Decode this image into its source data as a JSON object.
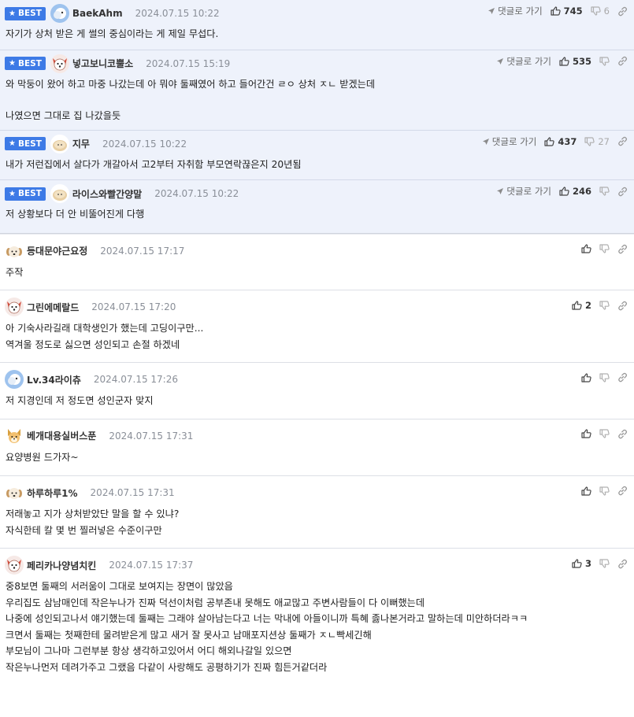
{
  "labels": {
    "best": "BEST",
    "reply": "댓글로 가기"
  },
  "colors": {
    "best_badge": "#3d7ae6",
    "best_bg": "#eef2fb"
  },
  "best_comments": [
    {
      "nick": "BaekAhm",
      "avatar": "blue-avatar",
      "date": "2024.07.15 10:22",
      "up": "745",
      "down": "6",
      "lines": [
        "자기가 상처 받은 게 썰의 중심이라는 게 제일 무섭다."
      ]
    },
    {
      "nick": "넣고보니코뿔소",
      "avatar": "dog-avatar",
      "date": "2024.07.15 15:19",
      "up": "535",
      "down": "",
      "lines": [
        "와 막둥이 왔어 하고 마중 나갔는데 아 뭐야 둘째였어 하고 들어간건 ㄹㅇ 상처 ㅈㄴ 받겠는데",
        "",
        "나였으면 그대로 집 나갔을듯"
      ]
    },
    {
      "nick": "지무",
      "avatar": "tan-avatar",
      "date": "2024.07.15 10:22",
      "up": "437",
      "down": "27",
      "lines": [
        "내가 저런집에서 살다가 개갈아서 고2부터 자취함 부모연락끊은지 20년됨"
      ]
    },
    {
      "nick": "라이스와빨간양말",
      "avatar": "tan-avatar",
      "date": "2024.07.15 10:22",
      "up": "246",
      "down": "",
      "lines": [
        "저 상황보다 더 안 비뚤어진게 다행"
      ]
    }
  ],
  "comments": [
    {
      "nick": "등대문야근요정",
      "avatar": "puppy-avatar",
      "date": "2024.07.15 17:17",
      "up": "",
      "lines": [
        "주작"
      ]
    },
    {
      "nick": "그린에메랄드",
      "avatar": "dog-avatar",
      "date": "2024.07.15 17:20",
      "up": "2",
      "lines": [
        "아 기숙사라길래 대학생인가 했는데 고딩이구만...",
        "역겨울 정도로 싫으면 성인되고 손절 하겠네"
      ]
    },
    {
      "nick": "Lv.34라이츄",
      "avatar": "blue-avatar",
      "date": "2024.07.15 17:26",
      "up": "",
      "lines": [
        "저 지경인데 저 정도면 성인군자 맞지"
      ]
    },
    {
      "nick": "베개대용실버스푼",
      "avatar": "cat-avatar",
      "date": "2024.07.15 17:31",
      "up": "",
      "lines": [
        "요양병원 드가자~"
      ]
    },
    {
      "nick": "하루하루1%",
      "avatar": "puppy-avatar",
      "date": "2024.07.15 17:31",
      "up": "",
      "lines": [
        "저래놓고 지가 상처받았단 말을 할 수 있냐?",
        "자식한테 칼 몇 번 찔러넣은 수준이구만"
      ]
    },
    {
      "nick": "페리카나양념치킨",
      "avatar": "dog-avatar",
      "date": "2024.07.15 17:37",
      "up": "3",
      "lines": [
        "중8보면 둘째의 서러움이 그대로 보여지는 장면이 많았음",
        "우리집도 삼남매인데 작은누나가 진짜 덕선이처럼 공부존내 못해도 애교많고 주변사람들이 다 이뻐했는데",
        "나중에 성인되고나서 얘기했는데 둘째는 그래야 살아남는다고 너는 막내에 아들이니까 특혜 졿나본거라고 말하는데 미안하더라ㅋㅋ",
        "크면서 둘째는 첫째한테 물려받은게 많고 새거 잘 못사고 남매포지션상 둘째가 ㅈㄴ빡세긴해",
        "부모님이 그나마 그런부분 항상 생각하고있어서 어디 해외나갈일 있으면",
        "작은누나먼저 데려가주고 그랬음 다같이 사랑해도 공평하기가 진짜 힘든거같더라"
      ]
    }
  ]
}
